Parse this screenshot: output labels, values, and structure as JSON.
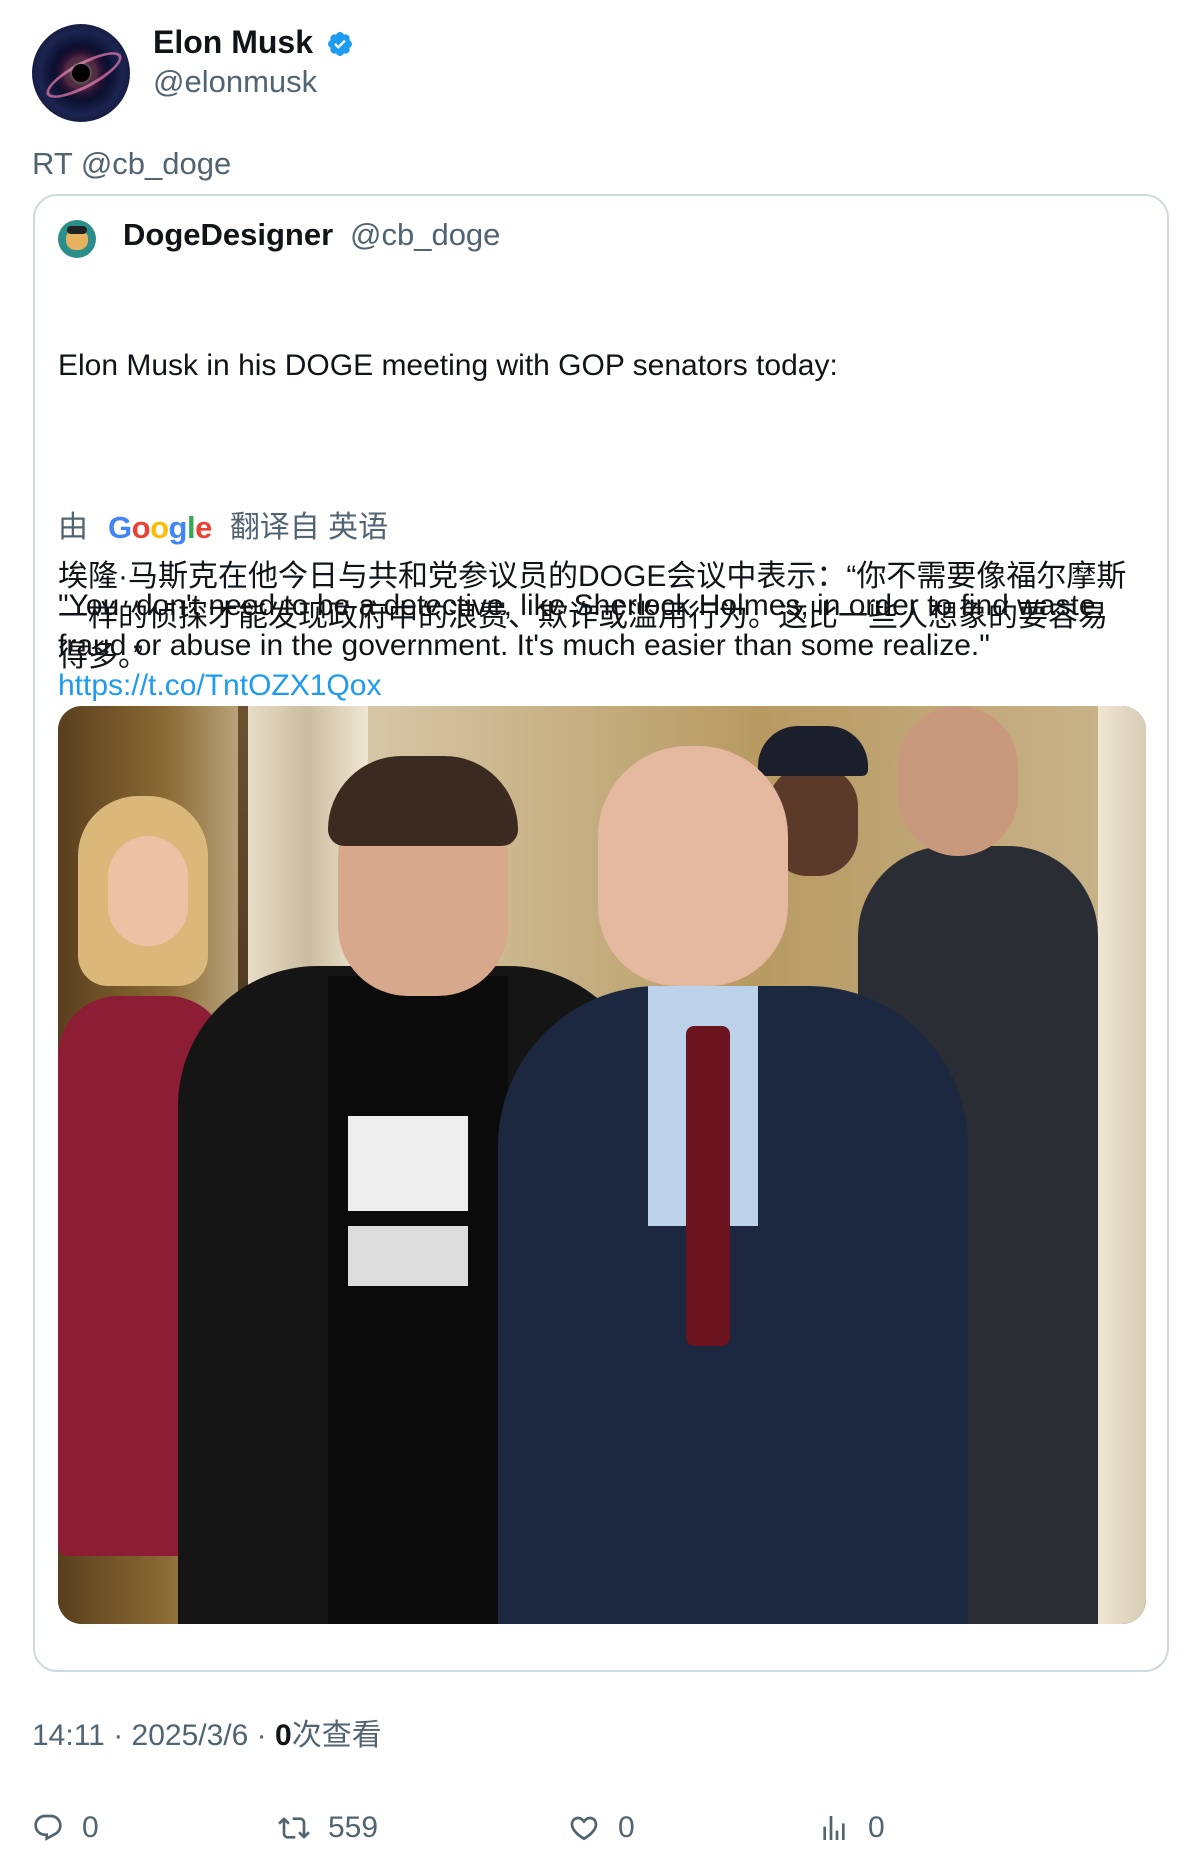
{
  "author": {
    "display_name": "Elon Musk",
    "handle": "@elonmusk",
    "verified": true,
    "verified_color": "#1d9bf0"
  },
  "retweet_label": "RT @cb_doge",
  "quoted": {
    "display_name": "DogeDesigner",
    "handle": "@cb_doge",
    "text_line1": "Elon Musk in his DOGE meeting with GOP senators today:",
    "text_quote": "\"You  don't need to be a detective, like Sherlock Holmes, in order to find waste, fraud or abuse in the government. It's much easier than some realize.\" ",
    "link": "https://t.co/TntOZX1Qox",
    "translation": {
      "prefix": "由",
      "provider": "Google",
      "suffix": "翻译自 英语",
      "text": "埃隆·马斯克在他今日与共和党参议员的DOGE会议中表示：“你不需要像福尔摩斯一样的侦探才能发现政府中的浪费、欺诈或滥用行为。这比一些人想象的要容易得多。”"
    }
  },
  "meta": {
    "time": "14:11",
    "date": "2025/3/6",
    "views_count": "0",
    "views_label": "次查看",
    "separator": "·"
  },
  "actions": {
    "replies": "0",
    "retweets": "559",
    "likes": "0",
    "views": "0"
  },
  "colors": {
    "text": "#0f1419",
    "secondary": "#536471",
    "link": "#1d9bf0",
    "border": "#cfd9de"
  },
  "icons": [
    "verified-badge-icon",
    "reply-icon",
    "retweet-icon",
    "like-icon",
    "views-icon",
    "google-logo"
  ]
}
